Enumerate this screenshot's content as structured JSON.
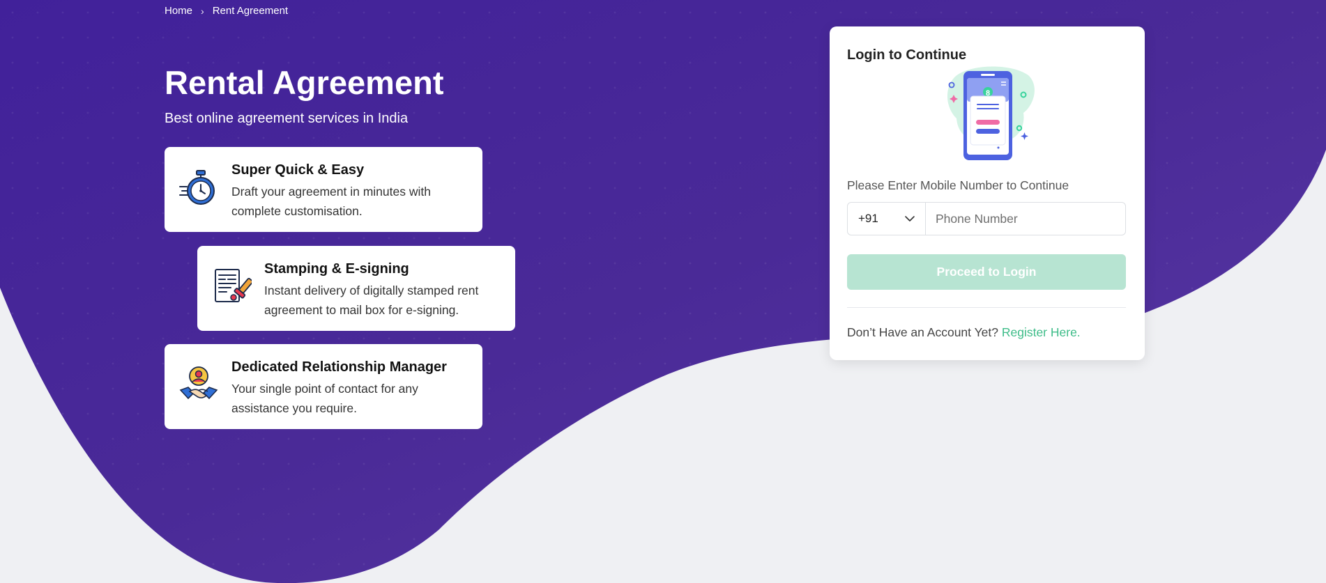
{
  "breadcrumb": {
    "home": "Home",
    "separator": "›",
    "current": "Rent Agreement"
  },
  "hero": {
    "title": "Rental Agreement",
    "subtitle": "Best online agreement services in India"
  },
  "features": [
    {
      "icon": "stopwatch-icon",
      "title": "Super Quick & Easy",
      "desc_line1": "Draft your agreement in minutes with",
      "desc_line2": "complete customisation."
    },
    {
      "icon": "document-stamp-icon",
      "title": "Stamping & E-signing",
      "desc_line1": "Instant delivery of digitally stamped rent",
      "desc_line2": "agreement to mail box for e-signing."
    },
    {
      "icon": "handshake-manager-icon",
      "title": "Dedicated Relationship Manager",
      "desc_line1": "Your single point of contact for any",
      "desc_line2": "assistance you require."
    }
  ],
  "login": {
    "title": "Login to Continue",
    "illustration": "mobile-login-illustration",
    "prompt": "Please Enter Mobile Number to Continue",
    "country_code": "+91",
    "phone_placeholder": "Phone Number",
    "proceed_label": "Proceed to Login",
    "no_account_text": "Don’t Have an Account Yet?",
    "register_label": "Register Here."
  },
  "colors": {
    "hero_purple": "#4b2a96",
    "hero_purple_dark": "#3e2388",
    "page_bg": "#eff0f3",
    "accent_green": "#3dbc88",
    "button_disabled_green": "#b7e4d2"
  }
}
